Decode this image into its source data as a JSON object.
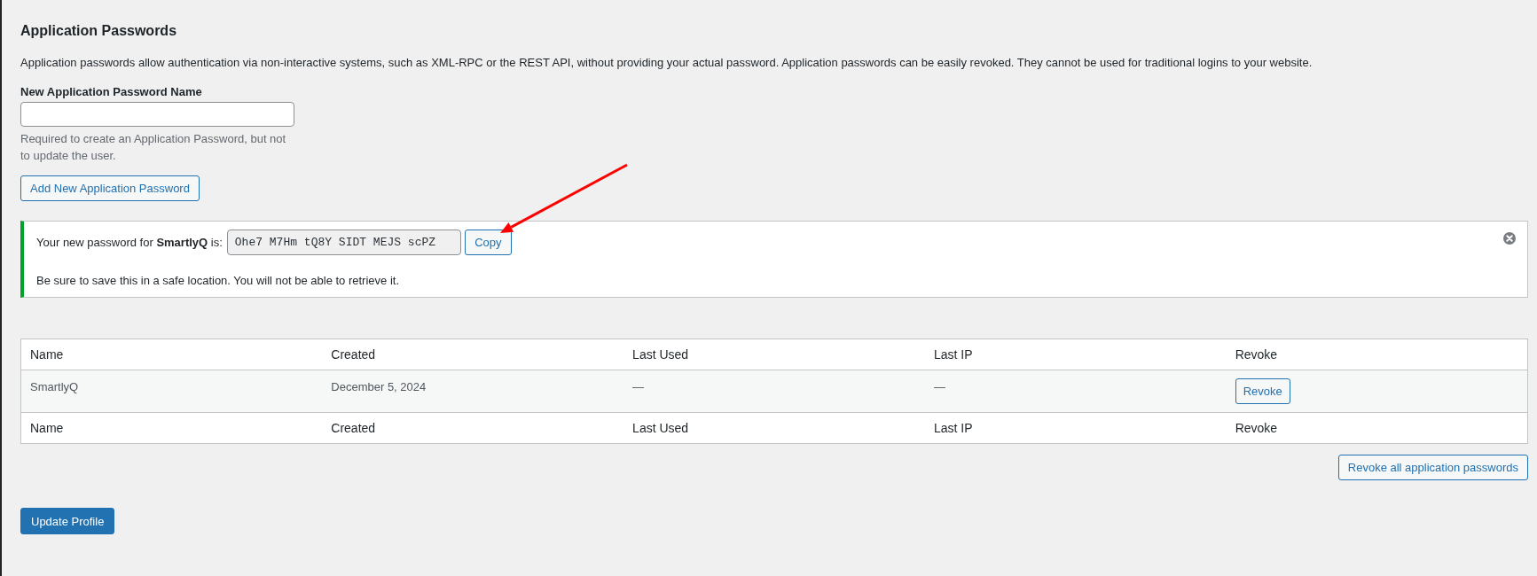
{
  "section": {
    "title": "Application Passwords",
    "description": "Application passwords allow authentication via non-interactive systems, such as XML-RPC or the REST API, without providing your actual password. Application passwords can be easily revoked. They cannot be used for traditional logins to your website."
  },
  "new_password": {
    "label": "New Application Password Name",
    "help": "Required to create an Application Password, but not to update the user.",
    "button": "Add New Application Password"
  },
  "notice": {
    "kind": "success",
    "message": "Your new password for **SmartlyQ** is:",
    "password": "Ohe7 M7Hm tQ8Y SIDT MEJS scPZ",
    "copy_button": "Copy",
    "note": "Be sure to save this in a safe location. You will not be able to retrieve it.",
    "dismissible": true
  },
  "table": {
    "columns": [
      "Name",
      "Created",
      "Last Used",
      "Last IP",
      "Revoke"
    ],
    "rows": [
      {
        "cells": [
          "SmartlyQ",
          "December 5, 2024",
          "—",
          "—"
        ],
        "action": "Revoke"
      }
    ],
    "footer_columns": [
      "Name",
      "Created",
      "Last Used",
      "Last IP",
      "Revoke"
    ]
  },
  "revoke_all_button": "Revoke all application passwords",
  "submit_button": "Update Profile"
}
